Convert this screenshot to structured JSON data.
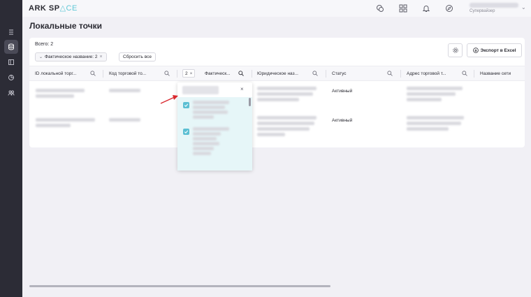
{
  "app": {
    "logo_main": "ARK SP",
    "logo_accent": "△CE"
  },
  "sidebar": {
    "icons": [
      "list-icon",
      "database-icon",
      "panel-icon",
      "chart-icon",
      "users-icon"
    ]
  },
  "topbar": {
    "icons": [
      "chat-icon",
      "apps-grid-icon",
      "bell-icon",
      "compass-icon"
    ],
    "user_role": "Супервайзер"
  },
  "page": {
    "title": "Локальные точки"
  },
  "toolbar": {
    "total": "Всего: 2",
    "filter_chip": "Фактическое название: 2",
    "reset_label": "Сбросить все",
    "export_label": "Экспорт в Excel"
  },
  "table": {
    "active_filter_count": "2",
    "columns": [
      "ID локальной торг...",
      "Код торговой то...",
      "Фактическ...",
      "Юридическое наз...",
      "Статус",
      "Адрес торговой т...",
      "Название сети"
    ],
    "rows": [
      {
        "status": "Активный"
      },
      {
        "status": "Активный"
      }
    ]
  },
  "colors": {
    "accent": "#5cbfd3",
    "sidebar_bg": "#2c2c36",
    "arrow": "#d9272d"
  }
}
